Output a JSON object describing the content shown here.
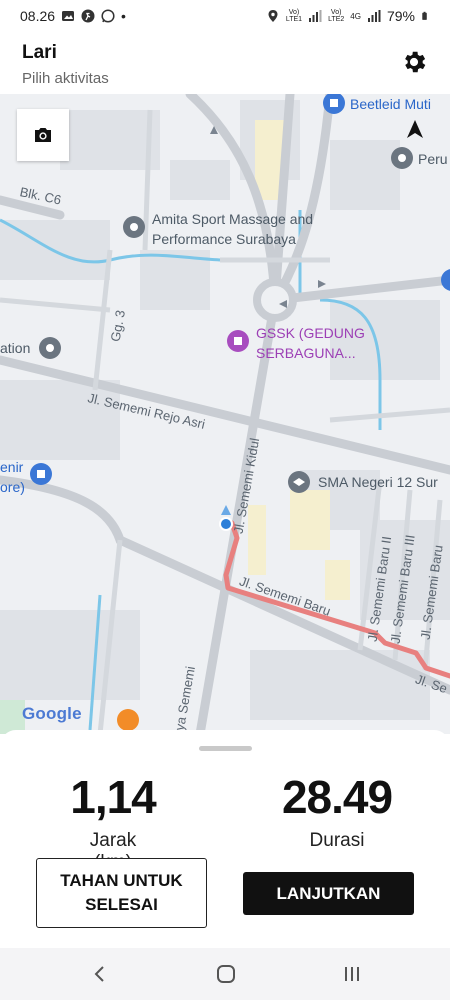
{
  "status_bar": {
    "time": "08.26",
    "battery": "79%",
    "sim1_label_top": "Vo)",
    "sim1_label_bottom": "LTE1",
    "sim2_label_top": "Vo)",
    "sim2_label_bottom": "LTE2",
    "network": "4G"
  },
  "header": {
    "title": "Lari",
    "subtitle": "Pilih aktivitas"
  },
  "map": {
    "pois": [
      {
        "name": "Beetleid Muti",
        "style": "blue"
      },
      {
        "name": "Peru",
        "style": "gray"
      },
      {
        "name": "Amita Sport Massage and",
        "style": "gray"
      },
      {
        "name": "Performance Surabaya",
        "style": "gray"
      },
      {
        "name": "GSSK (GEDUNG",
        "style": "purple"
      },
      {
        "name": "SERBAGUNA...",
        "style": "purple"
      },
      {
        "name": "ation",
        "style": "gray"
      },
      {
        "name": "SMA Negeri 12 Sur",
        "style": "gray"
      },
      {
        "name": "enir",
        "style": "blue"
      },
      {
        "name": "ore)",
        "style": "blue"
      }
    ],
    "streets": [
      "Blk. C6",
      "Gg. 3",
      "Jl. Sememi Rejo Asri",
      "Jl. Sememi Kidul",
      "Jl. Sememi Baru",
      "Jl. Se",
      "Jl. Sememi Baru II",
      "Jl. Sememi Baru III",
      "Jl. Sememi Baru",
      "aya Sememi"
    ],
    "attribution": "Google",
    "route_color": "#e8807f"
  },
  "sheet": {
    "distance_value": "1,14",
    "distance_label": "Jarak\n(km)",
    "duration_value": "28.49",
    "duration_label": "Durasi",
    "hold_button": "TAHAN UNTUK SELESAI",
    "continue_button": "LANJUTKAN"
  },
  "icons": {
    "camera": "camera-icon",
    "navigate": "navigation-arrow-icon",
    "settings": "gear-icon",
    "back": "back-chevron-icon",
    "home": "home-icon",
    "recents": "recents-icon"
  }
}
